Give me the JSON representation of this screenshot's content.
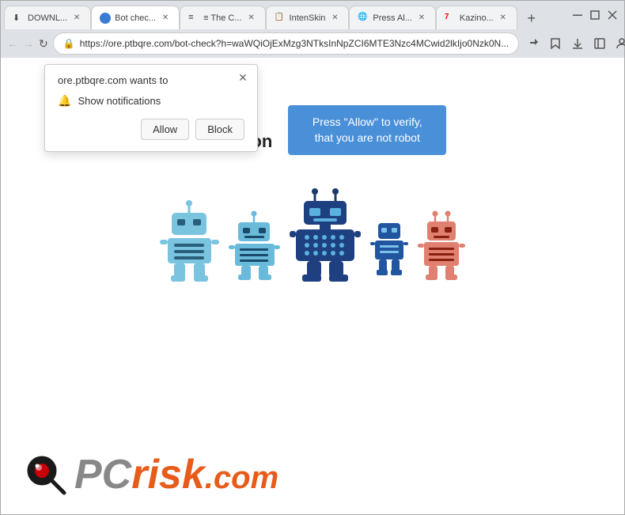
{
  "browser": {
    "tabs": [
      {
        "id": "tab1",
        "label": "DOWNL...",
        "favicon": "⬇",
        "active": false
      },
      {
        "id": "tab2",
        "label": "Bot chec...",
        "favicon": "🔵",
        "active": true
      },
      {
        "id": "tab3",
        "label": "≡ The C...",
        "favicon": "📄",
        "active": false
      },
      {
        "id": "tab4",
        "label": "IntenSkin",
        "favicon": "📋",
        "active": false
      },
      {
        "id": "tab5",
        "label": "Press Al...",
        "favicon": "🌐",
        "active": false
      },
      {
        "id": "tab6",
        "label": "Kazino...",
        "favicon": "7",
        "active": false
      }
    ],
    "address": "https://ore.ptbqre.com/bot-check?h=waWQiOjExMzg3NTksInNpZCI6MTE3Nzc4MCwid2lkIjo0Nzk0N...",
    "address_short": "https://ore.ptbqre.com/bot-check?h=waWQiOjExMzg3NTksInNpZCI6MTE3Nzc4MCwid2lkIjo0Nzk0N..."
  },
  "notification_popup": {
    "title": "ore.ptbqre.com wants to",
    "notification_label": "Show notifications",
    "allow_label": "Allow",
    "block_label": "Block"
  },
  "main_content": {
    "verification_title": "Human\nVerification",
    "verification_badge": "Press \"Allow\" to verify, that you are not robot"
  },
  "pcrisk": {
    "text_pc": "PC",
    "text_risk": "risk",
    "text_dotcom": ".com"
  }
}
